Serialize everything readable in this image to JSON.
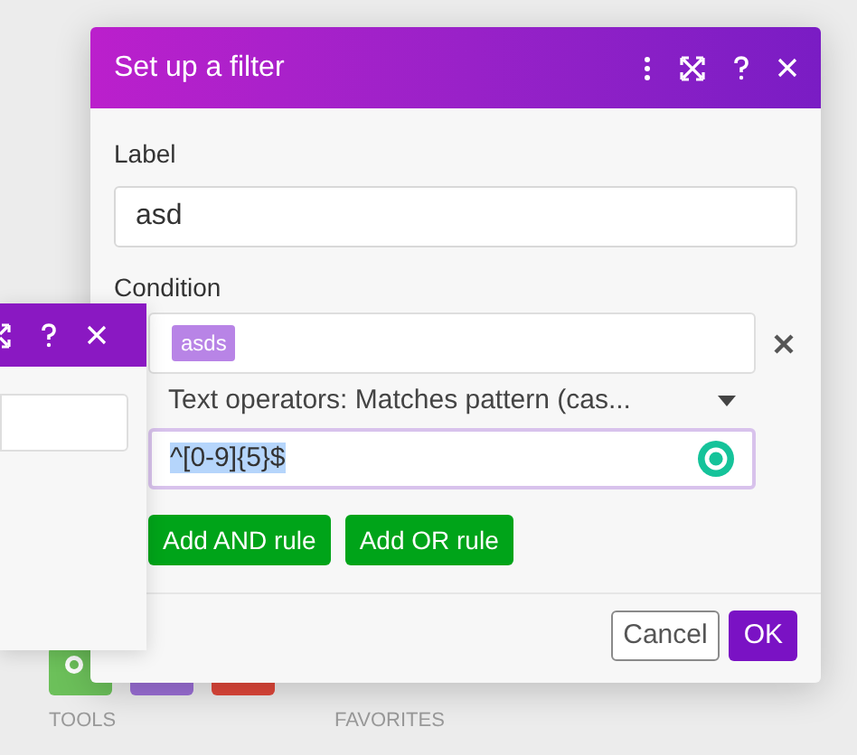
{
  "toolbar": {
    "groups": [
      {
        "label": "TOOLS"
      },
      {
        "label": "FAVORITES"
      }
    ]
  },
  "back_dialog": {
    "kind": "dialog"
  },
  "dialog": {
    "title": "Set up a filter",
    "label_field": {
      "label": "Label",
      "value": "asd"
    },
    "condition": {
      "label": "Condition",
      "tag": "asds",
      "operator": "Text operators: Matches pattern (cas...",
      "pattern": "^[0-9]{5}$"
    },
    "rule_buttons": [
      "Add AND rule",
      "Add OR rule"
    ],
    "footer_buttons": [
      {
        "label": "Cancel",
        "kind": "secondary"
      },
      {
        "label": "OK",
        "kind": "primary"
      }
    ]
  }
}
